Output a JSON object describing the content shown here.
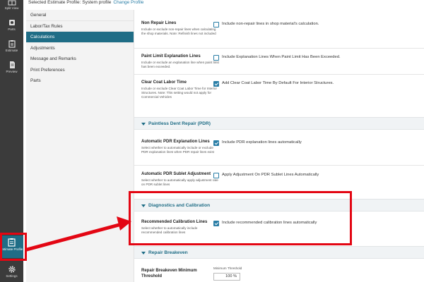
{
  "rail": {
    "split_view": "Split View",
    "parts": "Parts",
    "estimate": "Estimate",
    "preview": "Preview",
    "estimate_profile": "Estimate Profile",
    "settings": "Settings"
  },
  "header": {
    "profile_text": "Selected Estimate Profile:  System profile",
    "change_link": "Change Profile"
  },
  "nav": {
    "items": [
      {
        "label": "General"
      },
      {
        "label": "Labor/Tax Rules"
      },
      {
        "label": "Calculations"
      },
      {
        "label": "Adjustments"
      },
      {
        "label": "Message and Remarks"
      },
      {
        "label": "Print Preferences"
      },
      {
        "label": "Parts"
      }
    ]
  },
  "settings": {
    "non_repair": {
      "title": "Non Repair Lines",
      "desc": "Include or exclude non-repair lines when calculating the shop materials. Note: Refinish lines not included",
      "check_label": "Include non-repair lines in shop material's calculation.",
      "checked": false
    },
    "paint_limit": {
      "title": "Paint Limit Explanation Lines",
      "desc": "Include or exclude an explanation line when paint limit has been exceeded.",
      "check_label": "Include Explanation Lines When Paint Limit Has Been Exceeded.",
      "checked": false
    },
    "clear_coat": {
      "title": "Clear Coat Labor Time",
      "desc": "Include or exclude Clear Coat Labor Time for Interior Structures. Note: This setting would not apply for Commercial Vehicles",
      "check_label": "Add Clear Coat Labor Time By Default For Interior Structures.",
      "checked": true
    },
    "pdr_section": "Paintless Dent Repair (PDR)",
    "pdr_explanation": {
      "title": "Automatic PDR Explanation Lines",
      "desc": "Select whether to automatically include or exclude PDR explanation lines when PDR repair lines exist",
      "check_label": "Include PDR explanation lines automatically",
      "checked": true
    },
    "pdr_sublet": {
      "title": "Automatic PDR Sublet Adjustment",
      "desc": "Select whether to automatically apply adjustment rate on PDR sublet lines",
      "check_label": "Apply Adjustment On PDR Sublet Lines Automatically",
      "checked": false
    },
    "diag_section": "Diagnostics and Calibration",
    "calibration": {
      "title": "Recommended Calibration Lines",
      "desc": "Select whether to automatically include recommended calibration lines",
      "check_label": "Include recommended calibration lines automatically",
      "checked": true
    },
    "breakeven_section": "Repair Breakeven",
    "breakeven": {
      "title": "Repair Breakeven Minimum Threshold",
      "threshold_label": "Minimum Threshold",
      "threshold_value": "100 %"
    }
  },
  "colors": {
    "accent": "#1f6d86",
    "rail": "#3b3b3b",
    "highlight": "#e30613"
  }
}
